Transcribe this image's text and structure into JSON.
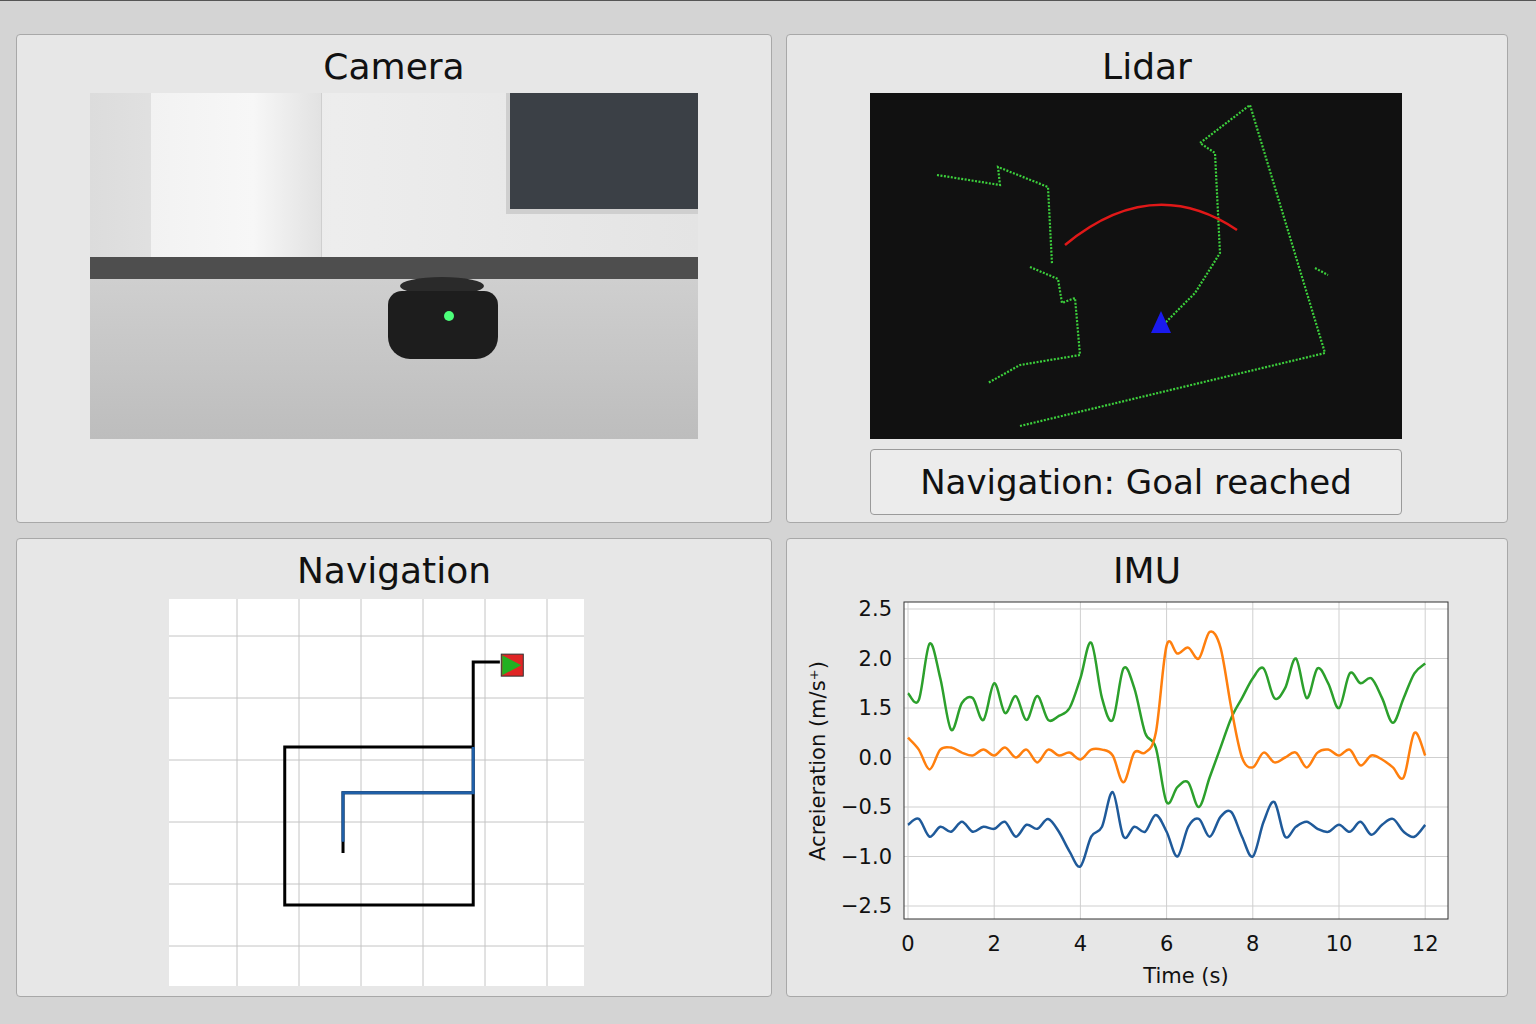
{
  "panels": {
    "camera": {
      "title": "Camera"
    },
    "lidar": {
      "title": "Lidar",
      "status": "Navigation: Goal reached"
    },
    "navigation": {
      "title": "Navigation",
      "paths": [
        {
          "color": "#000000",
          "points": [
            [
              2.71,
              4.5
            ],
            [
              2.71,
              3.53
            ],
            [
              4.81,
              3.53
            ],
            [
              4.81,
              2.79
            ],
            [
              1.77,
              2.79
            ],
            [
              1.77,
              5.34
            ],
            [
              4.81,
              5.34
            ],
            [
              4.81,
              1.42
            ],
            [
              5.24,
              1.42
            ]
          ]
        },
        {
          "color": "#1f5fa8",
          "points": [
            [
              2.71,
              4.32
            ],
            [
              2.71,
              3.53
            ],
            [
              4.81,
              3.53
            ],
            [
              4.81,
              2.79
            ]
          ]
        }
      ],
      "goal": {
        "x": 5.44,
        "y": 1.47
      }
    },
    "imu": {
      "title": "IMU",
      "chart": {
        "y_label": "Acreieration (m/s⁺)",
        "x_label": "Time (s)",
        "y_ticks": [
          {
            "label": "2.5",
            "value": 2.5
          },
          {
            "label": "2.0",
            "value": 2.0
          },
          {
            "label": "1.5",
            "value": 1.5
          },
          {
            "label": "0.0",
            "value": 0.0
          },
          {
            "label": "−0.5",
            "value": -0.5
          },
          {
            "label": "−1.0",
            "value": -1.0
          },
          {
            "label": "−2.5",
            "value": -2.5
          }
        ],
        "x_ticks": [
          {
            "label": "0",
            "value": 0
          },
          {
            "label": "2",
            "value": 2
          },
          {
            "label": "4",
            "value": 4
          },
          {
            "label": "6",
            "value": 6
          },
          {
            "label": "8",
            "value": 8
          },
          {
            "label": "10",
            "value": 10
          },
          {
            "label": "12",
            "value": 12
          }
        ],
        "x_step": 0.25,
        "series": [
          {
            "color": "#2ca02c",
            "values": [
              1.65,
              1.58,
              2.15,
              1.8,
              0.84,
              1.55,
              1.6,
              1.14,
              1.75,
              1.35,
              1.62,
              1.14,
              1.62,
              1.14,
              1.26,
              1.5,
              1.8,
              2.16,
              1.6,
              1.14,
              1.9,
              1.7,
              0.75,
              0.3,
              -0.45,
              -0.3,
              -0.25,
              -0.5,
              -0.2,
              0.3,
              1.2,
              1.6,
              1.8,
              1.9,
              1.6,
              1.7,
              2.0,
              1.6,
              1.9,
              1.75,
              1.5,
              1.85,
              1.75,
              1.8,
              1.6,
              1.05,
              1.6,
              1.85,
              1.95
            ]
          },
          {
            "color": "#ff7f0e",
            "values": [
              0.6,
              0.24,
              -0.12,
              0.24,
              0.3,
              0.15,
              0.06,
              0.24,
              0.06,
              0.3,
              0,
              0.24,
              -0.05,
              0.24,
              0.06,
              0.15,
              -0.02,
              0.24,
              0.24,
              0.06,
              -0.25,
              0.15,
              0.15,
              0.75,
              2.13,
              2.05,
              2.11,
              2.0,
              2.27,
              2.11,
              1.5,
              0,
              -0.1,
              0.15,
              -0.05,
              0,
              0.15,
              -0.1,
              0.15,
              0.24,
              0.06,
              0.24,
              -0.08,
              0.06,
              -0.02,
              -0.1,
              -0.2,
              0.75,
              0.06
            ]
          },
          {
            "color": "#1f5a9a",
            "values": [
              -0.68,
              -0.62,
              -0.8,
              -0.7,
              -0.75,
              -0.65,
              -0.75,
              -0.7,
              -0.72,
              -0.65,
              -0.8,
              -0.68,
              -0.72,
              -0.62,
              -0.75,
              -0.95,
              -1.3,
              -0.8,
              -0.7,
              -0.35,
              -0.8,
              -0.7,
              -0.75,
              -0.58,
              -0.75,
              -1.0,
              -0.7,
              -0.62,
              -0.8,
              -0.6,
              -0.55,
              -0.8,
              -1.0,
              -0.65,
              -0.45,
              -0.8,
              -0.7,
              -0.65,
              -0.72,
              -0.75,
              -0.68,
              -0.75,
              -0.65,
              -0.78,
              -0.68,
              -0.62,
              -0.75,
              -0.8,
              -0.68
            ]
          }
        ]
      }
    }
  }
}
